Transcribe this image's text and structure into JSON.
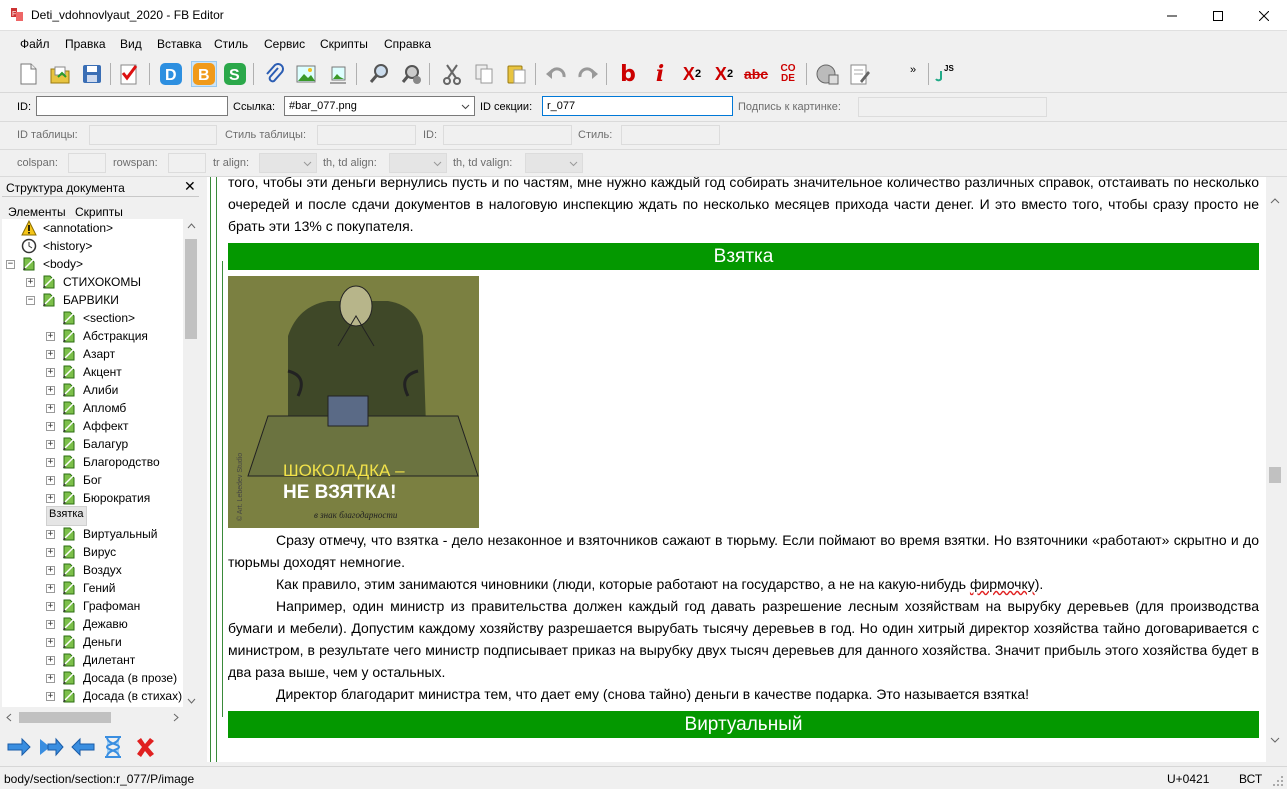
{
  "window": {
    "title": "Deti_vdohnovlyaut_2020 - FB Editor"
  },
  "menu": [
    "Файл",
    "Правка",
    "Вид",
    "Вставка",
    "Стиль",
    "Сервис",
    "Скрипты",
    "Справка"
  ],
  "toolbar": {
    "bold_glyph": "b",
    "italic_glyph": "i",
    "sup_glyph": "X",
    "sup_exp": "2",
    "sub_glyph": "X",
    "sub_exp": "2",
    "strike_glyph": "abc",
    "code_glyph": "CO DE",
    "more": "»",
    "js": "JS"
  },
  "fields": {
    "id_label": "ID:",
    "id_value": "",
    "link_label": "Ссылка:",
    "link_value": "#bar_077.png",
    "section_id_label": "ID секции:",
    "section_id_value": "r_077",
    "caption_label": "Подпись к картинке:",
    "caption_value": ""
  },
  "table_fields": {
    "table_id_label": "ID таблицы:",
    "table_style_label": "Стиль таблицы:",
    "id_label": "ID:",
    "style_label": "Стиль:"
  },
  "cell_fields": {
    "colspan_label": "colspan:",
    "rowspan_label": "rowspan:",
    "tr_align_label": "tr align:",
    "thtd_align_label": "th, td align:",
    "thtd_valign_label": "th, td valign:"
  },
  "panel": {
    "title": "Структура документа",
    "tab_elements": "Элементы",
    "tab_scripts": "Скрипты"
  },
  "tree": [
    {
      "label": "<annotation>",
      "icon": "warning-icon",
      "level": 0,
      "expander": "none"
    },
    {
      "label": "<history>",
      "icon": "clock-icon",
      "level": 0,
      "expander": "none"
    },
    {
      "label": "<body>",
      "icon": "section-icon",
      "level": 0,
      "expander": "minus"
    },
    {
      "label": "СТИХОКОМЫ",
      "icon": "section-icon",
      "level": 1,
      "expander": "plus"
    },
    {
      "label": "БАРВИКИ",
      "icon": "section-icon",
      "level": 1,
      "expander": "minus"
    },
    {
      "label": "<section>",
      "icon": "section-icon",
      "level": 2,
      "expander": "none"
    },
    {
      "label": "Абстракция",
      "icon": "section-icon",
      "level": 2,
      "expander": "plus"
    },
    {
      "label": "Азарт",
      "icon": "section-icon",
      "level": 2,
      "expander": "plus"
    },
    {
      "label": "Акцент",
      "icon": "section-icon",
      "level": 2,
      "expander": "plus"
    },
    {
      "label": "Алиби",
      "icon": "section-icon",
      "level": 2,
      "expander": "plus"
    },
    {
      "label": "Апломб",
      "icon": "section-icon",
      "level": 2,
      "expander": "plus"
    },
    {
      "label": "Аффект",
      "icon": "section-icon",
      "level": 2,
      "expander": "plus"
    },
    {
      "label": "Балагур",
      "icon": "section-icon",
      "level": 2,
      "expander": "plus"
    },
    {
      "label": "Благородство",
      "icon": "section-icon",
      "level": 2,
      "expander": "plus"
    },
    {
      "label": "Бог",
      "icon": "section-icon",
      "level": 2,
      "expander": "plus"
    },
    {
      "label": "Бюрократия",
      "icon": "section-icon",
      "level": 2,
      "expander": "plus"
    },
    {
      "label": "Взятка",
      "icon": "section-icon",
      "level": 2,
      "expander": "plus",
      "selected": true
    },
    {
      "label": "Виртуальный",
      "icon": "section-icon",
      "level": 2,
      "expander": "plus"
    },
    {
      "label": "Вирус",
      "icon": "section-icon",
      "level": 2,
      "expander": "plus"
    },
    {
      "label": "Воздух",
      "icon": "section-icon",
      "level": 2,
      "expander": "plus"
    },
    {
      "label": "Гений",
      "icon": "section-icon",
      "level": 2,
      "expander": "plus"
    },
    {
      "label": "Графоман",
      "icon": "section-icon",
      "level": 2,
      "expander": "plus"
    },
    {
      "label": "Дежавю",
      "icon": "section-icon",
      "level": 2,
      "expander": "plus"
    },
    {
      "label": "Деньги",
      "icon": "section-icon",
      "level": 2,
      "expander": "plus"
    },
    {
      "label": "Дилетант",
      "icon": "section-icon",
      "level": 2,
      "expander": "plus"
    },
    {
      "label": "Досада (в прозе)",
      "icon": "section-icon",
      "level": 2,
      "expander": "plus"
    },
    {
      "label": "Досада (в стихах)",
      "icon": "section-icon",
      "level": 2,
      "expander": "plus"
    }
  ],
  "editor": {
    "top_para": "того, чтобы эти деньги вернулись пусть и по частям, мне нужно каждый год собирать значительное количество различных справок, отстаивать по несколько очередей и после сдачи документов в налоговую инспекцию ждать по несколько месяцев прихода части денег. И это вместо того, чтобы сразу просто не брать эти 13% с покупателя.",
    "section1_title": "Взятка",
    "image": {
      "headline1": "ШОКОЛАДКА –",
      "headline2": "НЕ ВЗЯТКА!",
      "subline": "в знак благодарности",
      "credit": "© Art. Lebedev Studio",
      "colors": {
        "background": "#7a8040",
        "text_yellow": "#f2e24a"
      }
    },
    "p1": "Сразу отмечу, что взятка - дело незаконное и взяточников сажают в тюрьму. Если поймают во время взятки. Но взяточники «работают» скрытно и до тюрьмы доходят немногие.",
    "p2_before": "Как правило, этим занимаются чиновники (люди, которые работают на государство, а не на какую-нибудь ",
    "p2_mark": "фирмочку",
    "p2_after": ").",
    "p3": "Например, один министр из правительства должен каждый год давать разрешение лесным хозяйствам на вырубку деревьев (для производства бумаги и мебели). Допустим каждому хозяйству разрешается вырубать тысячу деревьев в год. Но один хитрый директор хозяйства тайно договаривается с министром, в результате чего министр подписывает приказ на вырубку двух тысяч деревьев для данного хозяйства. Значит прибыль этого хозяйства будет в два раза выше, чем у остальных.",
    "p4": "Директор благодарит министра тем, что дает ему (снова тайно) деньги в качестве подарка. Это называется взятка!",
    "section2_title": "Виртуальный"
  },
  "status": {
    "path": "body/section/section:r_077/P/image",
    "unicode": "U+0421",
    "mode": "ВСТ"
  },
  "colors": {
    "section_green": "#049800",
    "accent_blue": "#0078d7"
  }
}
